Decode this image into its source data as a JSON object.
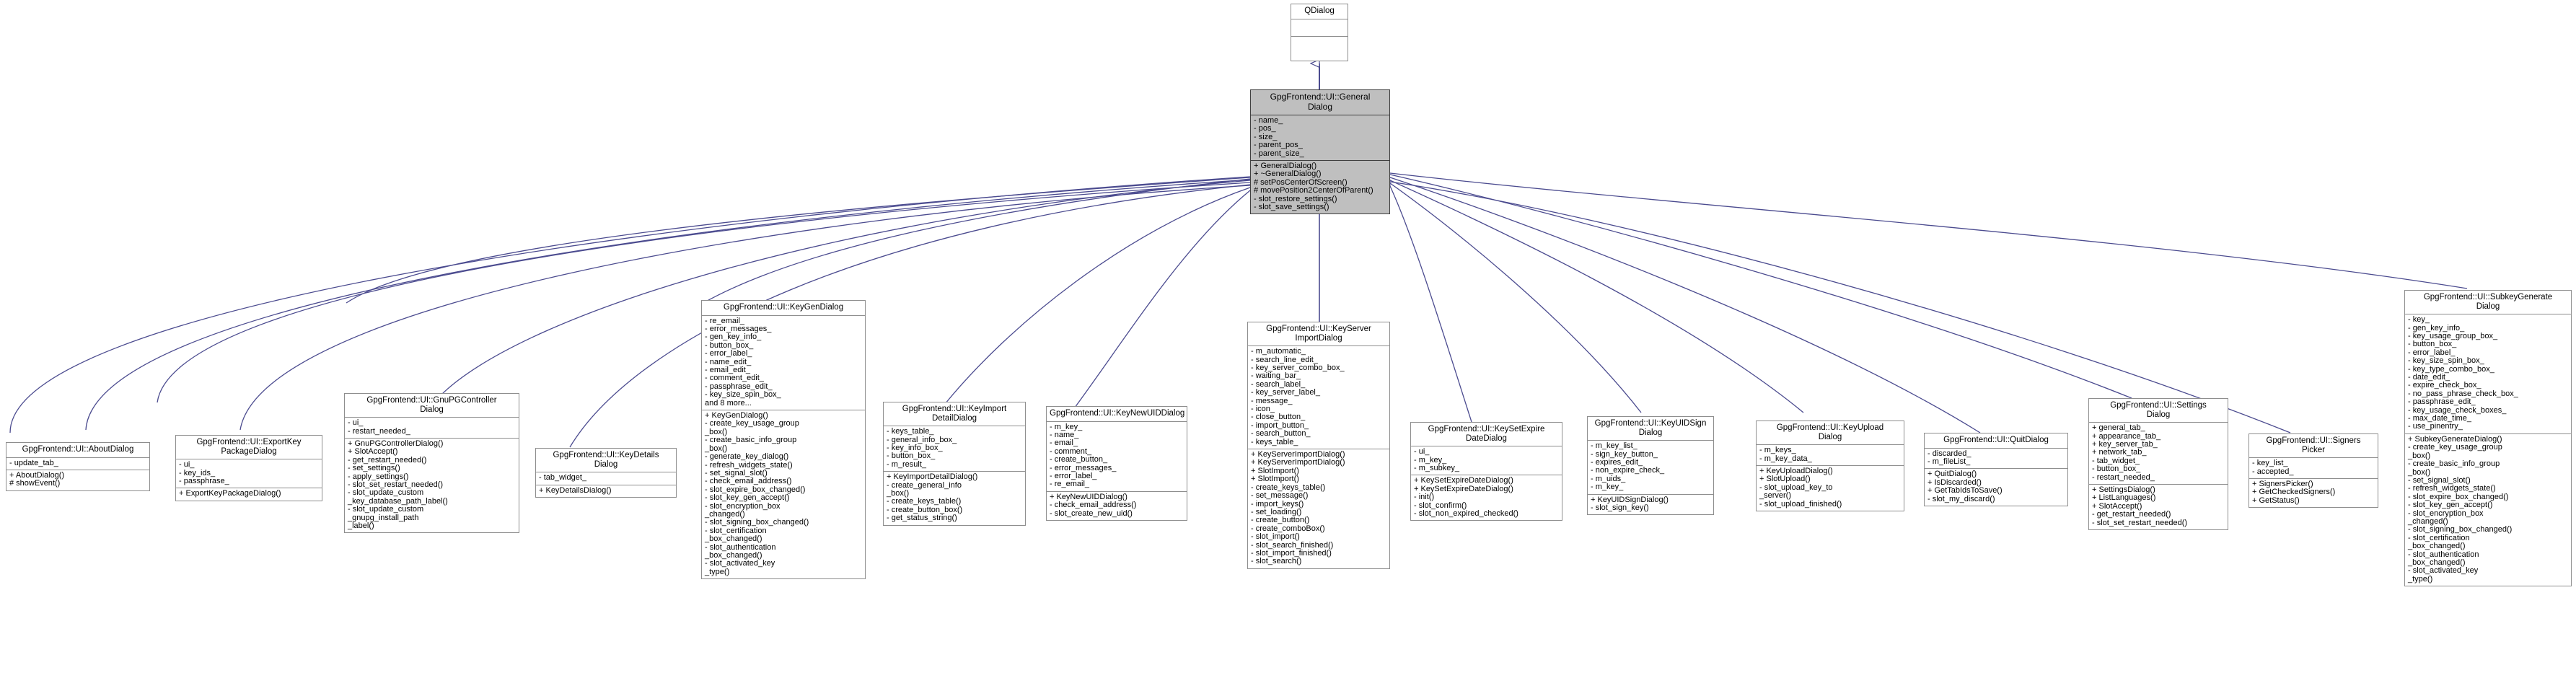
{
  "diagram": {
    "kind": "uml-inheritance",
    "title": "GpgFrontend::UI::GeneralDialog inheritance graph",
    "colors": {
      "node_border": "#8e8e8e",
      "base_fill": "#bfbfbf",
      "base_border": "#404040",
      "edge": "#4b4b8f",
      "background": "#ffffff",
      "text": "#000000"
    }
  },
  "nodes": {
    "qdialog": {
      "title": "QDialog",
      "attrs": "",
      "ops": ""
    },
    "general_dialog": {
      "title": "GpgFrontend::UI::General\nDialog",
      "attrs": "- name_\n- pos_\n- size_\n- parent_pos_\n- parent_size_",
      "ops": "+ GeneralDialog()\n+ ~GeneralDialog()\n# setPosCenterOfScreen()\n# movePosition2CenterOfParent()\n- slot_restore_settings()\n- slot_save_settings()"
    },
    "about_dialog": {
      "title": "GpgFrontend::UI::AboutDialog",
      "attrs": "- update_tab_",
      "ops": "+ AboutDialog()\n# showEvent()"
    },
    "export_key_package_dialog": {
      "title": "GpgFrontend::UI::ExportKey\nPackageDialog",
      "attrs": "- ui_\n- key_ids_\n- passphrase_",
      "ops": "+ ExportKeyPackageDialog()"
    },
    "gnupg_controller_dialog": {
      "title": "GpgFrontend::UI::GnuPGController\nDialog",
      "attrs": "- ui_\n- restart_needed_",
      "ops": "+ GnuPGControllerDialog()\n+ SlotAccept()\n- get_restart_needed()\n- set_settings()\n- apply_settings()\n- slot_set_restart_needed()\n- slot_update_custom\n_key_database_path_label()\n- slot_update_custom\n_gnupg_install_path\n_label()"
    },
    "key_details_dialog": {
      "title": "GpgFrontend::UI::KeyDetails\nDialog",
      "attrs": "- tab_widget_",
      "ops": "+ KeyDetailsDialog()"
    },
    "key_gen_dialog": {
      "title": "GpgFrontend::UI::KeyGenDialog",
      "attrs": "- re_email_\n- error_messages_\n- gen_key_info_\n- button_box_\n- error_label_\n- name_edit_\n- email_edit_\n- comment_edit_\n- passphrase_edit_\n- key_size_spin_box_\nand 8 more...",
      "ops": "+ KeyGenDialog()\n- create_key_usage_group\n_box()\n- create_basic_info_group\n_box()\n- generate_key_dialog()\n- refresh_widgets_state()\n- set_signal_slot()\n- check_email_address()\n- slot_expire_box_changed()\n- slot_key_gen_accept()\n- slot_encryption_box\n_changed()\n- slot_signing_box_changed()\n- slot_certification\n_box_changed()\n- slot_authentication\n_box_changed()\n- slot_activated_key\n_type()"
    },
    "key_import_detail_dialog": {
      "title": "GpgFrontend::UI::KeyImport\nDetailDialog",
      "attrs": "- keys_table_\n- general_info_box_\n- key_info_box_\n- button_box_\n- m_result_",
      "ops": "+ KeyImportDetailDialog()\n- create_general_info\n_box()\n- create_keys_table()\n- create_button_box()\n- get_status_string()"
    },
    "key_new_uid_dialog": {
      "title": "GpgFrontend::UI::KeyNewUIDDialog",
      "attrs": "- m_key_\n- name_\n- email_\n- comment_\n- create_button_\n- error_messages_\n- error_label_\n- re_email_",
      "ops": "+ KeyNewUIDDialog()\n- check_email_address()\n- slot_create_new_uid()"
    },
    "key_server_import_dialog": {
      "title": "GpgFrontend::UI::KeyServer\nImportDialog",
      "attrs": "- m_automatic_\n- search_line_edit_\n- key_server_combo_box_\n- waiting_bar_\n- search_label_\n- key_server_label_\n- message_\n- icon_\n- close_button_\n- import_button_\n- search_button_\n- keys_table_",
      "ops": "+ KeyServerImportDialog()\n+ KeyServerImportDialog()\n+ SlotImport()\n+ SlotImport()\n- create_keys_table()\n- set_message()\n- import_keys()\n- set_loading()\n- create_button()\n- create_comboBox()\n- slot_import()\n- slot_search_finished()\n- slot_import_finished()\n- slot_search()"
    },
    "key_set_expire_date_dialog": {
      "title": "GpgFrontend::UI::KeySetExpire\nDateDialog",
      "attrs": "- ui_\n- m_key_\n- m_subkey_",
      "ops": "+ KeySetExpireDateDialog()\n+ KeySetExpireDateDialog()\n- init()\n- slot_confirm()\n- slot_non_expired_checked()"
    },
    "key_uid_sign_dialog": {
      "title": "GpgFrontend::UI::KeyUIDSign\nDialog",
      "attrs": "- m_key_list_\n- sign_key_button_\n- expires_edit_\n- non_expire_check_\n- m_uids_\n- m_key_",
      "ops": "+ KeyUIDSignDialog()\n- slot_sign_key()"
    },
    "key_upload_dialog": {
      "title": "GpgFrontend::UI::KeyUpload\nDialog",
      "attrs": "- m_keys_\n- m_key_data_",
      "ops": "+ KeyUploadDialog()\n+ SlotUpload()\n- slot_upload_key_to\n_server()\n- slot_upload_finished()"
    },
    "quit_dialog": {
      "title": "GpgFrontend::UI::QuitDialog",
      "attrs": "- discarded_\n- m_fileList_",
      "ops": "+ QuitDialog()\n+ IsDiscarded()\n+ GetTabIdsToSave()\n- slot_my_discard()"
    },
    "settings_dialog": {
      "title": "GpgFrontend::UI::Settings\nDialog",
      "attrs": "+ general_tab_\n+ appearance_tab_\n+ key_server_tab_\n+ network_tab_\n- tab_widget_\n- button_box_\n- restart_needed_",
      "ops": "+ SettingsDialog()\n+ ListLanguages()\n+ SlotAccept()\n- get_restart_needed()\n- slot_set_restart_needed()"
    },
    "signers_picker": {
      "title": "GpgFrontend::UI::Signers\nPicker",
      "attrs": "- key_list_\n- accepted_",
      "ops": "+ SignersPicker()\n+ GetCheckedSigners()\n+ GetStatus()"
    },
    "subkey_generate_dialog": {
      "title": "GpgFrontend::UI::SubkeyGenerate\nDialog",
      "attrs": "- key_\n- gen_key_info_\n- key_usage_group_box_\n- button_box_\n- error_label_\n- key_size_spin_box_\n- key_type_combo_box_\n- date_edit_\n- expire_check_box_\n- no_pass_phrase_check_box_\n- passphrase_edit_\n- key_usage_check_boxes_\n- max_date_time_\n- use_pinentry_",
      "ops": "+ SubkeyGenerateDialog()\n- create_key_usage_group\n_box()\n- create_basic_info_group\n_box()\n- set_signal_slot()\n- refresh_widgets_state()\n- slot_expire_box_changed()\n- slot_key_gen_accept()\n- slot_encryption_box\n_changed()\n- slot_signing_box_changed()\n- slot_certification\n_box_changed()\n- slot_authentication\n_box_changed()\n- slot_activated_key\n_type()"
    }
  }
}
